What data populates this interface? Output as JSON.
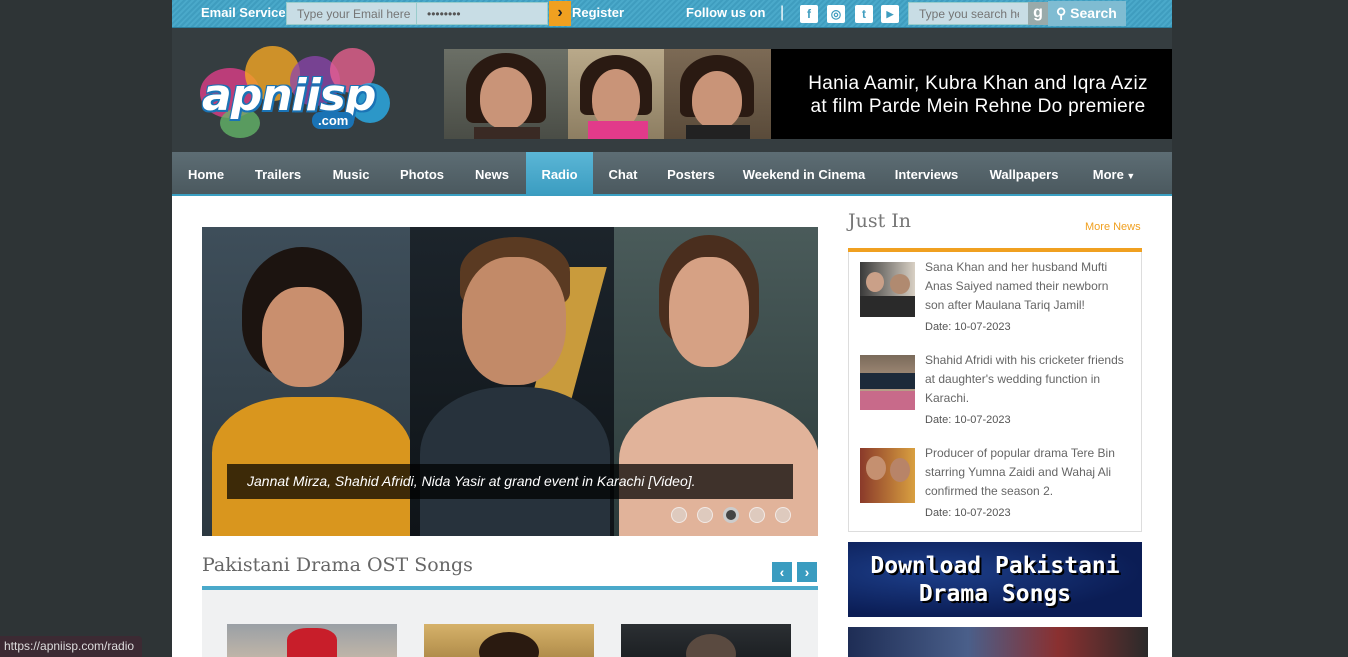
{
  "topbar": {
    "email_label": "Email Service",
    "email_placeholder": "Type your Email here",
    "password_value": "••••••••",
    "go_icon": "chevron-right-icon",
    "register_label": "Register",
    "follow_label": "Follow us on",
    "social": [
      {
        "name": "facebook-icon",
        "glyph": "f"
      },
      {
        "name": "instagram-icon",
        "glyph": "◎"
      },
      {
        "name": "twitter-icon",
        "glyph": "t"
      },
      {
        "name": "youtube-icon",
        "glyph": "▶"
      }
    ],
    "search_placeholder": "Type you search here",
    "search_label": "Search"
  },
  "logo": {
    "text": "apniisp",
    "domain": ".com"
  },
  "banner": {
    "line1": "Hania Aamir, Kubra Khan and Iqra Aziz",
    "line2": "at film Parde Mein Rehne Do premiere"
  },
  "nav": {
    "items": [
      "Home",
      "Trailers",
      "Music",
      "Photos",
      "News",
      "Radio",
      "Chat",
      "Posters",
      "Weekend in Cinema",
      "Interviews",
      "Wallpapers",
      "More"
    ],
    "active": "Radio"
  },
  "slider": {
    "caption": "Jannat Mirza, Shahid Afridi, Nida Yasir at grand event in Karachi [Video].",
    "slide_count": 5,
    "active_slide": 3
  },
  "ost": {
    "title": "Pakistani Drama OST Songs",
    "prev": "‹",
    "next": "›"
  },
  "justin": {
    "title": "Just In",
    "more_label": "More News",
    "items": [
      {
        "text": "Sana Khan and her husband Mufti Anas Saiyed named their newborn son after Maulana Tariq Jamil!",
        "date": "Date: 10-07-2023"
      },
      {
        "text": "Shahid Afridi with his cricketer friends at daughter's wedding function in Karachi.",
        "date": "Date: 10-07-2023"
      },
      {
        "text": "Producer of popular drama Tere Bin starring Yumna Zaidi and Wahaj Ali confirmed the season 2.",
        "date": "Date: 10-07-2023"
      }
    ]
  },
  "download_banner": {
    "line1": "Download Pakistani",
    "line2": "Drama Songs"
  },
  "status_url": "https://apniisp.com/radio",
  "colors": {
    "accent": "#3a9cc0",
    "orange": "#f0a020",
    "nav": "#55646b",
    "page_bg": "#2e3436"
  }
}
